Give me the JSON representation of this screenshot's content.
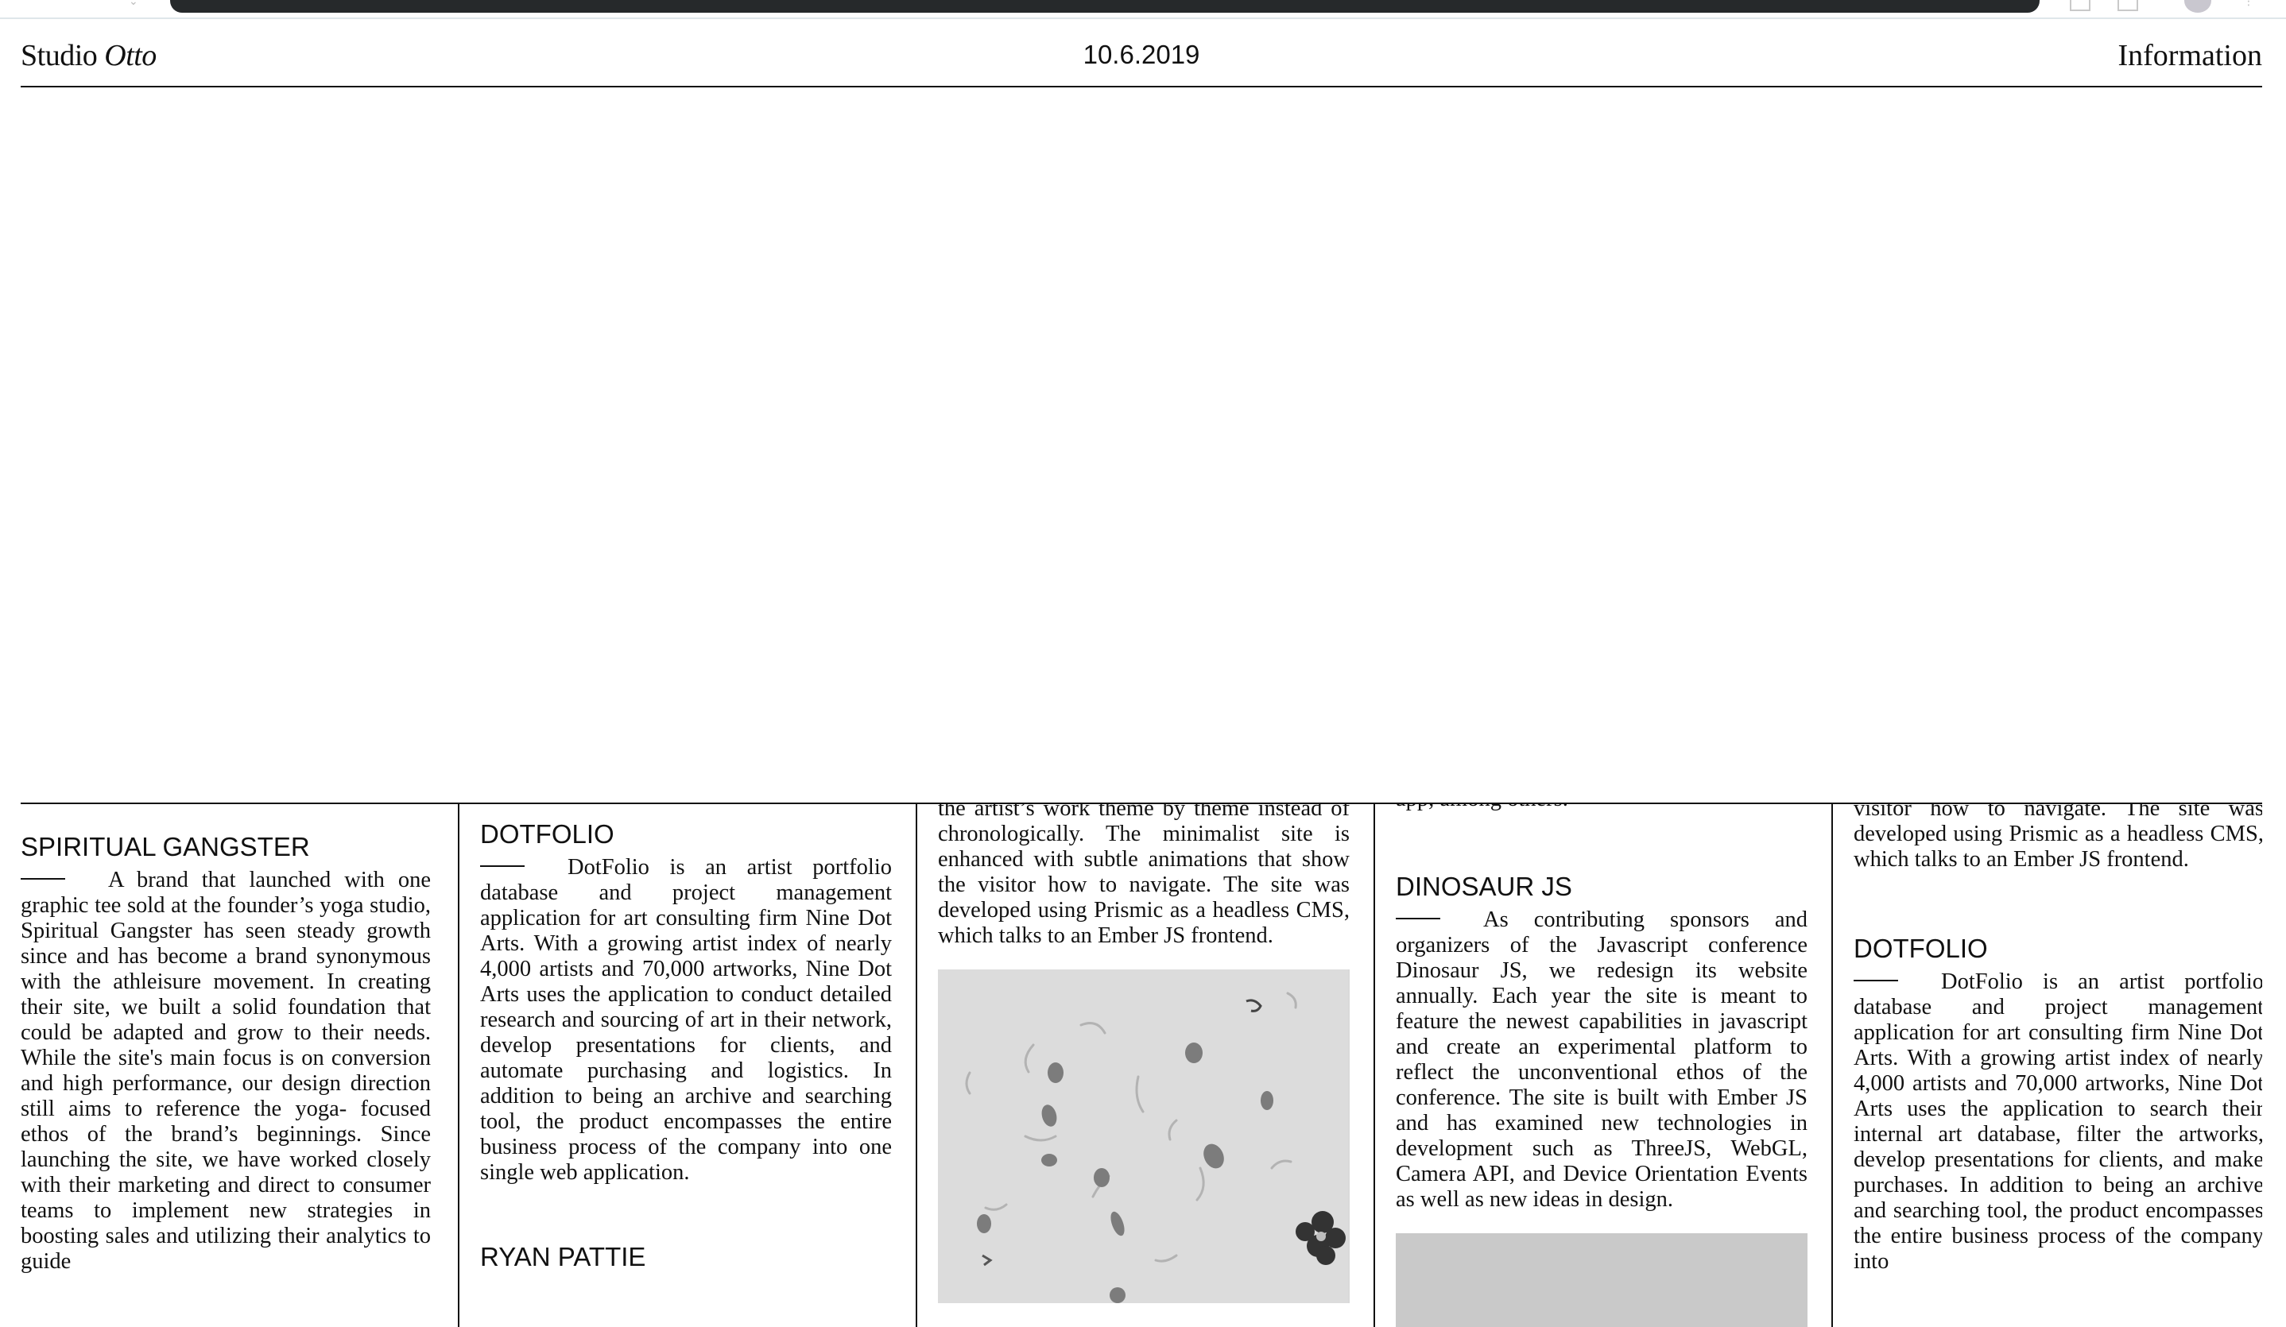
{
  "header": {
    "brand_plain": "Studio ",
    "brand_italic": "Otto",
    "date": "10.6.2019",
    "info_link": "Information"
  },
  "columns": [
    {
      "projects": [
        {
          "title": "SPIRITUAL GANGSTER",
          "description": "A brand that launched with one graphic tee sold at the founder’s yoga studio, Spiritual Gangster has seen steady growth since and has become a brand synonymous with the athleisure movement. In creating their site, we built a solid foundation that could be adapted and grow to their needs. While the site's main focus is on conversion and high performance, our design direction still aims to reference the yoga- focused ethos of the brand’s beginnings. Since launching the site, we have worked closely with their marketing and direct to consumer teams to implement new strategies in boosting sales and utilizing their analytics to guide"
        }
      ]
    },
    {
      "projects": [
        {
          "title": "DOTFOLIO",
          "description": "DotFolio is an artist portfolio database and project management application for art consulting firm Nine Dot Arts. With a growing artist index of nearly 4,000 artists and 70,000 artworks, Nine Dot Arts uses the application to conduct detailed research and sourcing of art in their network, develop presentations for clients, and automate purchasing and logistics. In addition to being an archive and searching tool, the product encompasses the entire business process of the company into one single web application."
        },
        {
          "title": "RYAN PATTIE",
          "description": ""
        }
      ]
    },
    {
      "continued_text": "the artist’s work theme by theme instead of chronologically. The minimalist site is enhanced with subtle animations that show the visitor how to navigate. The site was developed using Prismic as a headless CMS, which talks to an Ember JS frontend.",
      "image_icon": "organism-scatter-illustration"
    },
    {
      "continued_text": "app, among others.",
      "projects": [
        {
          "title": "DINOSAUR JS",
          "description": "As contributing sponsors and organizers of the Javascript conference Dinosaur JS, we redesign its website annually. Each year the site is meant to feature the newest capabilities in javascript and create an experimental platform to reflect the unconventional ethos of the conference. The site is built with Ember JS and has examined new technologies in development such as ThreeJS, WebGL, Camera API, and Device Orientation Events as well as new ideas in design."
        }
      ],
      "image_icon": "gray-placeholder-image"
    },
    {
      "continued_text": "visitor how to navigate. The site was developed using Prismic as a headless CMS, which talks to an Ember JS frontend.",
      "projects": [
        {
          "title": "DOTFOLIO",
          "description": "DotFolio is an artist portfolio database and project management application for art consulting firm Nine Dot Arts. With a growing artist index of nearly 4,000 artists and 70,000 artworks, Nine Dot Arts uses the application to search their internal art database, filter the artworks, develop presentations for clients, and make purchases. In addition to being an archive and searching tool, the product encompasses the entire business process of the company into"
        }
      ]
    }
  ],
  "colors": {
    "ink": "#111111",
    "background": "#ffffff",
    "image_gray": "#d9d9d9",
    "placeholder_gray": "#c9c9c9"
  }
}
